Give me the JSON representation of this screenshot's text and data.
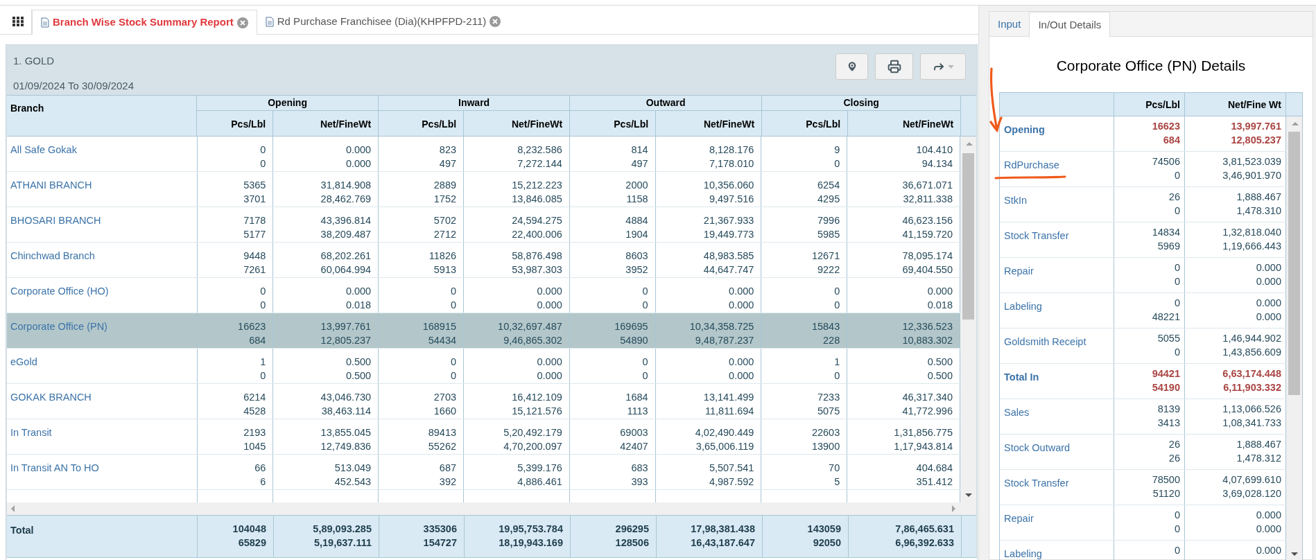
{
  "main_tabs": [
    {
      "label": "Branch Wise Stock Summary Report",
      "selected": true
    },
    {
      "label": "Rd Purchase Franchisee (Dia)(KHPFPD-211)",
      "selected": false
    }
  ],
  "report": {
    "title": "1. GOLD",
    "date_range": "01/09/2024 To 30/09/2024",
    "table": {
      "branch_header": "Branch",
      "groups": [
        {
          "label": "Opening",
          "columns": [
            "Pcs/Lbl",
            "Net/FineWt"
          ]
        },
        {
          "label": "Inward",
          "columns": [
            "Pcs/Lbl",
            "Net/FineWt"
          ]
        },
        {
          "label": "Outward",
          "columns": [
            "Pcs/Lbl",
            "Net/FineWt"
          ]
        },
        {
          "label": "Closing",
          "columns": [
            "Pcs/Lbl",
            "Net/FineWt"
          ]
        }
      ],
      "rows": [
        {
          "branch": "All Safe Gokak",
          "selected": false,
          "cells": [
            [
              "0",
              "0"
            ],
            [
              "0.000",
              "0.000"
            ],
            [
              "823",
              "497"
            ],
            [
              "8,232.586",
              "7,272.144"
            ],
            [
              "814",
              "497"
            ],
            [
              "8,128.176",
              "7,178.010"
            ],
            [
              "9",
              "0"
            ],
            [
              "104.410",
              "94.134"
            ]
          ]
        },
        {
          "branch": "ATHANI BRANCH",
          "selected": false,
          "cells": [
            [
              "5365",
              "3701"
            ],
            [
              "31,814.908",
              "28,462.769"
            ],
            [
              "2889",
              "1752"
            ],
            [
              "15,212.223",
              "13,846.085"
            ],
            [
              "2000",
              "1158"
            ],
            [
              "10,356.060",
              "9,497.516"
            ],
            [
              "6254",
              "4295"
            ],
            [
              "36,671.071",
              "32,811.338"
            ]
          ]
        },
        {
          "branch": "BHOSARI BRANCH",
          "selected": false,
          "cells": [
            [
              "7178",
              "5177"
            ],
            [
              "43,396.814",
              "38,209.487"
            ],
            [
              "5702",
              "2712"
            ],
            [
              "24,594.275",
              "22,400.006"
            ],
            [
              "4884",
              "1904"
            ],
            [
              "21,367.933",
              "19,449.773"
            ],
            [
              "7996",
              "5985"
            ],
            [
              "46,623.156",
              "41,159.720"
            ]
          ]
        },
        {
          "branch": "Chinchwad Branch",
          "selected": false,
          "cells": [
            [
              "9448",
              "7261"
            ],
            [
              "68,202.261",
              "60,064.994"
            ],
            [
              "11826",
              "5913"
            ],
            [
              "58,876.498",
              "53,987.303"
            ],
            [
              "8603",
              "3952"
            ],
            [
              "48,983.585",
              "44,647.747"
            ],
            [
              "12671",
              "9222"
            ],
            [
              "78,095.174",
              "69,404.550"
            ]
          ]
        },
        {
          "branch": "Corporate Office (HO)",
          "selected": false,
          "cells": [
            [
              "0",
              "0"
            ],
            [
              "0.000",
              "0.018"
            ],
            [
              "0",
              "0"
            ],
            [
              "0.000",
              "0.000"
            ],
            [
              "0",
              "0"
            ],
            [
              "0.000",
              "0.000"
            ],
            [
              "0",
              "0"
            ],
            [
              "0.000",
              "0.018"
            ]
          ]
        },
        {
          "branch": "Corporate Office (PN)",
          "selected": true,
          "cells": [
            [
              "16623",
              "684"
            ],
            [
              "13,997.761",
              "12,805.237"
            ],
            [
              "168915",
              "54434"
            ],
            [
              "10,32,697.487",
              "9,46,865.302"
            ],
            [
              "169695",
              "54890"
            ],
            [
              "10,34,358.725",
              "9,48,787.237"
            ],
            [
              "15843",
              "228"
            ],
            [
              "12,336.523",
              "10,883.302"
            ]
          ]
        },
        {
          "branch": "eGold",
          "selected": false,
          "cells": [
            [
              "1",
              "0"
            ],
            [
              "0.500",
              "0.500"
            ],
            [
              "0",
              "0"
            ],
            [
              "0.000",
              "0.000"
            ],
            [
              "0",
              "0"
            ],
            [
              "0.000",
              "0.000"
            ],
            [
              "1",
              "0"
            ],
            [
              "0.500",
              "0.500"
            ]
          ]
        },
        {
          "branch": "GOKAK BRANCH",
          "selected": false,
          "cells": [
            [
              "6214",
              "4528"
            ],
            [
              "43,046.730",
              "38,463.114"
            ],
            [
              "2703",
              "1660"
            ],
            [
              "16,412.109",
              "15,121.576"
            ],
            [
              "1684",
              "1113"
            ],
            [
              "13,141.499",
              "11,811.694"
            ],
            [
              "7233",
              "5075"
            ],
            [
              "46,317.340",
              "41,772.996"
            ]
          ]
        },
        {
          "branch": "In Transit",
          "selected": false,
          "cells": [
            [
              "2193",
              "1045"
            ],
            [
              "13,855.045",
              "12,749.836"
            ],
            [
              "89413",
              "55262"
            ],
            [
              "5,20,492.179",
              "4,70,200.097"
            ],
            [
              "69003",
              "42407"
            ],
            [
              "4,02,490.449",
              "3,65,006.119"
            ],
            [
              "22603",
              "13900"
            ],
            [
              "1,31,856.775",
              "1,17,943.814"
            ]
          ]
        },
        {
          "branch": "In Transit AN To HO",
          "selected": false,
          "cells": [
            [
              "66",
              "6"
            ],
            [
              "513.049",
              "452.543"
            ],
            [
              "687",
              "392"
            ],
            [
              "5,399.176",
              "4,886.461"
            ],
            [
              "683",
              "393"
            ],
            [
              "5,507.541",
              "4,987.592"
            ],
            [
              "70",
              "5"
            ],
            [
              "404.684",
              "351.412"
            ]
          ]
        }
      ],
      "total": {
        "label": "Total",
        "cells": [
          [
            "104048",
            "65829"
          ],
          [
            "5,89,093.285",
            "5,19,637.111"
          ],
          [
            "335306",
            "154727"
          ],
          [
            "19,95,753.784",
            "18,19,943.169"
          ],
          [
            "296295",
            "128506"
          ],
          [
            "17,98,381.438",
            "16,43,187.647"
          ],
          [
            "143059",
            "92050"
          ],
          [
            "7,86,465.631",
            "6,96,392.633"
          ]
        ]
      }
    }
  },
  "side_tabs": [
    {
      "label": "Input",
      "selected": false
    },
    {
      "label": "In/Out Details",
      "selected": true
    }
  ],
  "details": {
    "title": "Corporate Office (PN) Details",
    "columns": [
      "Pcs/Lbl",
      "Net/Fine Wt"
    ],
    "rows": [
      {
        "label": "Opening",
        "kind": "summary",
        "pcs": [
          "16623",
          "684"
        ],
        "wt": [
          "13,997.761",
          "12,805.237"
        ]
      },
      {
        "label": "RdPurchase",
        "kind": "item",
        "pcs": [
          "74506",
          "0"
        ],
        "wt": [
          "3,81,523.039",
          "3,46,901.970"
        ]
      },
      {
        "label": "StkIn",
        "kind": "item",
        "pcs": [
          "26",
          "0"
        ],
        "wt": [
          "1,888.467",
          "1,478.310"
        ]
      },
      {
        "label": "Stock Transfer",
        "kind": "item",
        "pcs": [
          "14834",
          "5969"
        ],
        "wt": [
          "1,32,818.040",
          "1,19,666.443"
        ]
      },
      {
        "label": "Repair",
        "kind": "item",
        "pcs": [
          "0",
          "0"
        ],
        "wt": [
          "0.000",
          "0.000"
        ]
      },
      {
        "label": "Labeling",
        "kind": "item",
        "pcs": [
          "0",
          "48221"
        ],
        "wt": [
          "0.000",
          "0.000"
        ]
      },
      {
        "label": "Goldsmith Receipt",
        "kind": "item",
        "pcs": [
          "5055",
          "0"
        ],
        "wt": [
          "1,46,944.902",
          "1,43,856.609"
        ]
      },
      {
        "label": "Total In",
        "kind": "summary",
        "pcs": [
          "94421",
          "54190"
        ],
        "wt": [
          "6,63,174.448",
          "6,11,903.332"
        ]
      },
      {
        "label": "Sales",
        "kind": "item",
        "pcs": [
          "8139",
          "3413"
        ],
        "wt": [
          "1,13,066.526",
          "1,08,341.733"
        ]
      },
      {
        "label": "Stock Outward",
        "kind": "item",
        "pcs": [
          "26",
          "26"
        ],
        "wt": [
          "1,888.467",
          "1,478.312"
        ]
      },
      {
        "label": "Stock Transfer",
        "kind": "item",
        "pcs": [
          "78500",
          "51120"
        ],
        "wt": [
          "4,07,699.610",
          "3,69,028.120"
        ]
      },
      {
        "label": "Repair",
        "kind": "item",
        "pcs": [
          "0",
          "0"
        ],
        "wt": [
          "0.000",
          "0.000"
        ]
      },
      {
        "label": "Labeling",
        "kind": "item",
        "pcs": [
          "0"
        ],
        "wt": [
          "0.000"
        ]
      }
    ]
  }
}
